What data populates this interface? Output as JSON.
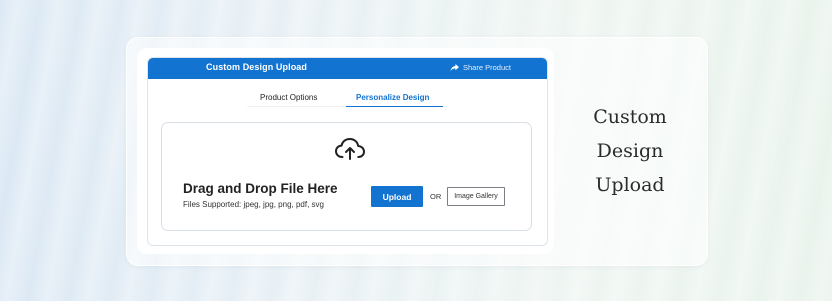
{
  "widget": {
    "header_title": "Custom Design Upload",
    "share_label": "Share Product",
    "share_icon": "share-arrow-icon",
    "accent_color": "#1273d0"
  },
  "tabs": [
    {
      "label": "Product Options",
      "active": false
    },
    {
      "label": "Personalize Design",
      "active": true
    }
  ],
  "dropzone": {
    "icon": "cloud-upload-icon",
    "title": "Drag and Drop File Here",
    "subtitle": "Files Supported: jpeg, jpg, png, pdf, svg",
    "upload_label": "Upload",
    "or_label": "OR",
    "gallery_label": "Image Gallery"
  },
  "side_title": [
    "Custom",
    "Design",
    "Upload"
  ]
}
